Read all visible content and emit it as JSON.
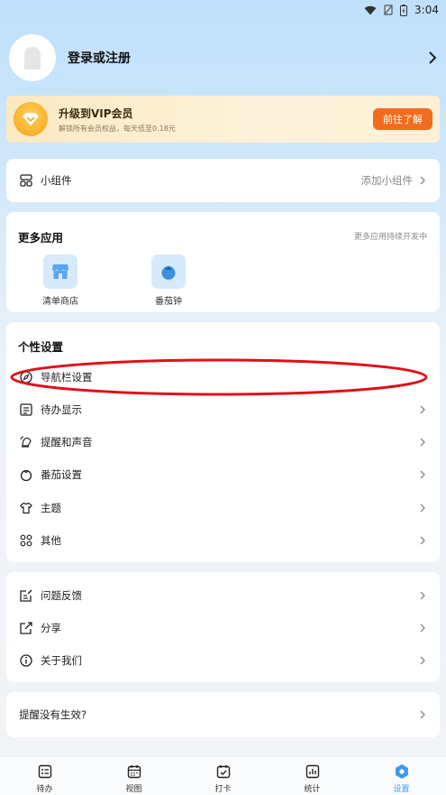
{
  "status_bar": {
    "time": "3:04",
    "icons": [
      "wifi-icon",
      "no-sim-icon",
      "battery-icon"
    ]
  },
  "profile": {
    "login_label": "登录或注册"
  },
  "vip": {
    "title": "升级到VIP会员",
    "subtitle": "解锁所有会员权益，每天低至0.18元",
    "button": "前往了解",
    "colors": {
      "badge": "#f7a21c",
      "button": "#f26c1f"
    }
  },
  "widget": {
    "label": "小组件",
    "value": "添加小组件"
  },
  "more_apps": {
    "title": "更多应用",
    "note": "更多应用持续开发中",
    "apps": [
      {
        "label": "清单商店",
        "icon": "store-icon"
      },
      {
        "label": "番茄钟",
        "icon": "tomato-icon"
      }
    ]
  },
  "personal": {
    "title": "个性设置",
    "items": [
      {
        "label": "导航栏设置",
        "icon": "navbar-icon"
      },
      {
        "label": "待办显示",
        "icon": "list-icon"
      },
      {
        "label": "提醒和声音",
        "icon": "bell-icon"
      },
      {
        "label": "番茄设置",
        "icon": "tomato-icon"
      },
      {
        "label": "主题",
        "icon": "shirt-icon"
      },
      {
        "label": "其他",
        "icon": "grid-icon"
      }
    ]
  },
  "misc": {
    "items": [
      {
        "label": "问题反馈",
        "icon": "feedback-icon"
      },
      {
        "label": "分享",
        "icon": "share-icon"
      },
      {
        "label": "关于我们",
        "icon": "info-icon"
      }
    ]
  },
  "reminder_help": {
    "label": "提醒没有生效?"
  },
  "tabbar": {
    "active_color": "#3a9bf2",
    "tabs": [
      {
        "label": "待办",
        "icon": "todo-icon"
      },
      {
        "label": "视图",
        "icon": "calendar-icon"
      },
      {
        "label": "打卡",
        "icon": "checkin-icon"
      },
      {
        "label": "统计",
        "icon": "stats-icon"
      },
      {
        "label": "设置",
        "icon": "settings-icon"
      }
    ]
  }
}
